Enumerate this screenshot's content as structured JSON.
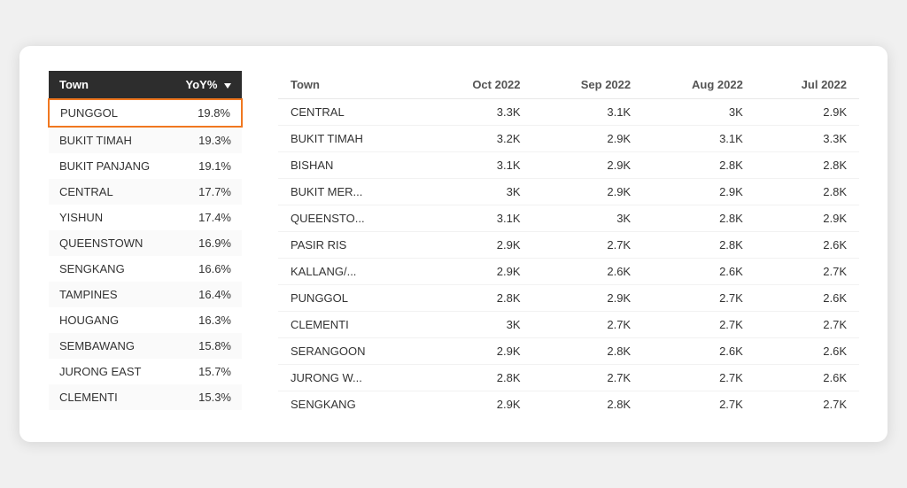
{
  "leftTable": {
    "columns": [
      "Town",
      "YoY%"
    ],
    "rows": [
      {
        "town": "PUNGGOL",
        "yoy": "19.8%",
        "highlighted": true
      },
      {
        "town": "BUKIT TIMAH",
        "yoy": "19.3%",
        "highlighted": false
      },
      {
        "town": "BUKIT PANJANG",
        "yoy": "19.1%",
        "highlighted": false
      },
      {
        "town": "CENTRAL",
        "yoy": "17.7%",
        "highlighted": false
      },
      {
        "town": "YISHUN",
        "yoy": "17.4%",
        "highlighted": false
      },
      {
        "town": "QUEENSTOWN",
        "yoy": "16.9%",
        "highlighted": false
      },
      {
        "town": "SENGKANG",
        "yoy": "16.6%",
        "highlighted": false
      },
      {
        "town": "TAMPINES",
        "yoy": "16.4%",
        "highlighted": false
      },
      {
        "town": "HOUGANG",
        "yoy": "16.3%",
        "highlighted": false
      },
      {
        "town": "SEMBAWANG",
        "yoy": "15.8%",
        "highlighted": false
      },
      {
        "town": "JURONG EAST",
        "yoy": "15.7%",
        "highlighted": false
      },
      {
        "town": "CLEMENTI",
        "yoy": "15.3%",
        "highlighted": false
      }
    ]
  },
  "rightTable": {
    "columns": [
      "Town",
      "Oct 2022",
      "Sep 2022",
      "Aug 2022",
      "Jul 2022"
    ],
    "rows": [
      {
        "town": "CENTRAL",
        "oct": "3.3K",
        "sep": "3.1K",
        "aug": "3K",
        "jul": "2.9K"
      },
      {
        "town": "BUKIT TIMAH",
        "oct": "3.2K",
        "sep": "2.9K",
        "aug": "3.1K",
        "jul": "3.3K"
      },
      {
        "town": "BISHAN",
        "oct": "3.1K",
        "sep": "2.9K",
        "aug": "2.8K",
        "jul": "2.8K"
      },
      {
        "town": "BUKIT MER...",
        "oct": "3K",
        "sep": "2.9K",
        "aug": "2.9K",
        "jul": "2.8K"
      },
      {
        "town": "QUEENSTO...",
        "oct": "3.1K",
        "sep": "3K",
        "aug": "2.8K",
        "jul": "2.9K"
      },
      {
        "town": "PASIR RIS",
        "oct": "2.9K",
        "sep": "2.7K",
        "aug": "2.8K",
        "jul": "2.6K"
      },
      {
        "town": "KALLANG/...",
        "oct": "2.9K",
        "sep": "2.6K",
        "aug": "2.6K",
        "jul": "2.7K"
      },
      {
        "town": "PUNGGOL",
        "oct": "2.8K",
        "sep": "2.9K",
        "aug": "2.7K",
        "jul": "2.6K"
      },
      {
        "town": "CLEMENTI",
        "oct": "3K",
        "sep": "2.7K",
        "aug": "2.7K",
        "jul": "2.7K"
      },
      {
        "town": "SERANGOON",
        "oct": "2.9K",
        "sep": "2.8K",
        "aug": "2.6K",
        "jul": "2.6K"
      },
      {
        "town": "JURONG W...",
        "oct": "2.8K",
        "sep": "2.7K",
        "aug": "2.7K",
        "jul": "2.6K"
      },
      {
        "town": "SENGKANG",
        "oct": "2.9K",
        "sep": "2.8K",
        "aug": "2.7K",
        "jul": "2.7K"
      }
    ]
  }
}
